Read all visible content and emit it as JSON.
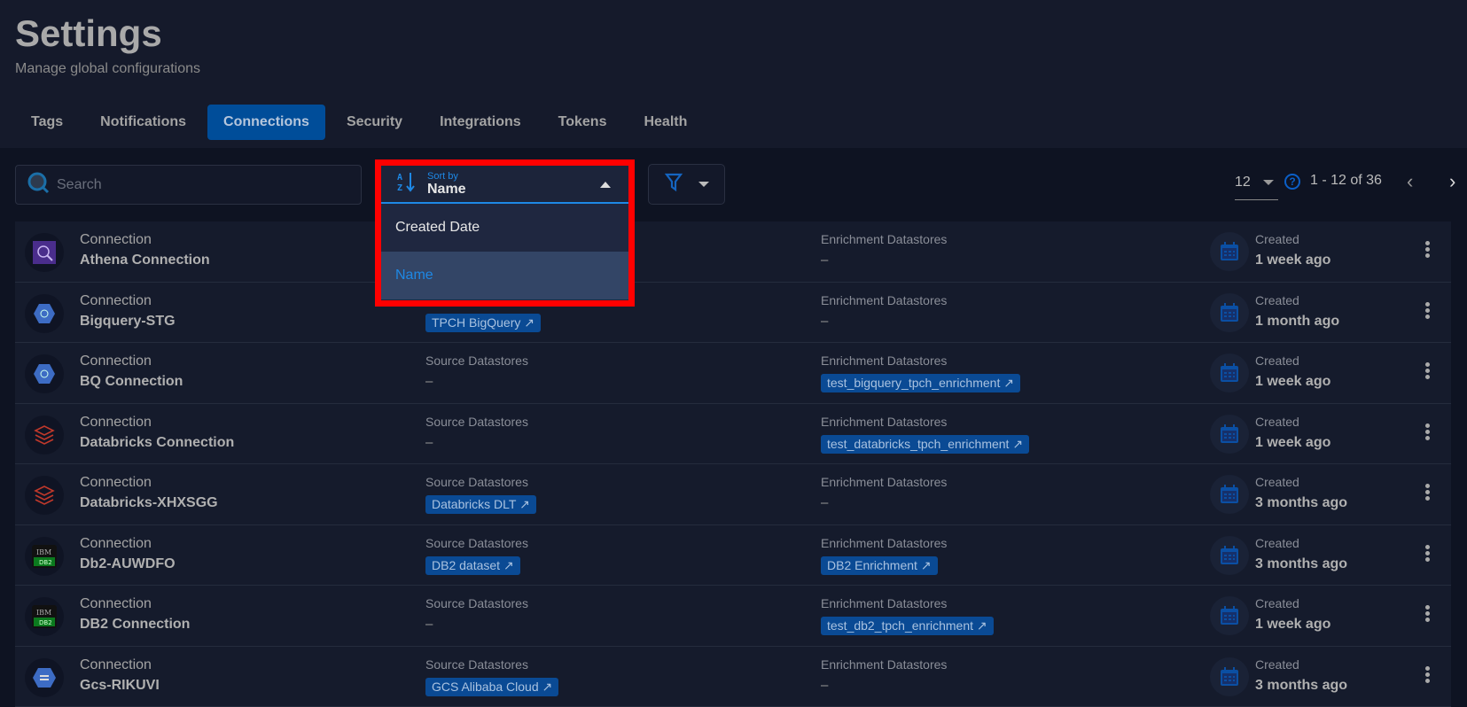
{
  "header": {
    "title": "Settings",
    "subtitle": "Manage global configurations"
  },
  "tabs": [
    {
      "label": "Tags"
    },
    {
      "label": "Notifications"
    },
    {
      "label": "Connections",
      "active": true
    },
    {
      "label": "Security"
    },
    {
      "label": "Integrations"
    },
    {
      "label": "Tokens"
    },
    {
      "label": "Health"
    }
  ],
  "search": {
    "placeholder": "Search",
    "value": ""
  },
  "sort": {
    "label": "Sort by",
    "value": "Name",
    "options": [
      "Created Date",
      "Name"
    ]
  },
  "pagination": {
    "per_page": "12",
    "range": "1 - 12 of 36"
  },
  "colors": {
    "accent": "#1e88e5",
    "tab_active": "#004d99",
    "tag_bg": "#0a4a94",
    "highlight": "#ff0000"
  },
  "rows": [
    {
      "type": "Connection",
      "name": "Athena Connection",
      "icon": "athena",
      "source_label": "",
      "source": "",
      "enrich_label": "Enrichment Datastores",
      "enrich": "–",
      "enrich_tag": false,
      "created_label": "Created",
      "created": "1 week ago"
    },
    {
      "type": "Connection",
      "name": "Bigquery-STG",
      "icon": "bigquery",
      "source_label": "",
      "source": "TPCH BigQuery",
      "source_tag": true,
      "enrich_label": "Enrichment Datastores",
      "enrich": "–",
      "enrich_tag": false,
      "created_label": "Created",
      "created": "1 month ago"
    },
    {
      "type": "Connection",
      "name": "BQ Connection",
      "icon": "bigquery",
      "source_label": "Source Datastores",
      "source": "–",
      "source_tag": false,
      "enrich_label": "Enrichment Datastores",
      "enrich": "test_bigquery_tpch_enrichment",
      "enrich_tag": true,
      "created_label": "Created",
      "created": "1 week ago"
    },
    {
      "type": "Connection",
      "name": "Databricks Connection",
      "icon": "databricks",
      "source_label": "Source Datastores",
      "source": "–",
      "source_tag": false,
      "enrich_label": "Enrichment Datastores",
      "enrich": "test_databricks_tpch_enrichment",
      "enrich_tag": true,
      "created_label": "Created",
      "created": "1 week ago"
    },
    {
      "type": "Connection",
      "name": "Databricks-XHXSGG",
      "icon": "databricks",
      "source_label": "Source Datastores",
      "source": "Databricks DLT",
      "source_tag": true,
      "enrich_label": "Enrichment Datastores",
      "enrich": "–",
      "enrich_tag": false,
      "created_label": "Created",
      "created": "3 months ago"
    },
    {
      "type": "Connection",
      "name": "Db2-AUWDFO",
      "icon": "db2",
      "source_label": "Source Datastores",
      "source": "DB2 dataset",
      "source_tag": true,
      "enrich_label": "Enrichment Datastores",
      "enrich": "DB2 Enrichment",
      "enrich_tag": true,
      "created_label": "Created",
      "created": "3 months ago"
    },
    {
      "type": "Connection",
      "name": "DB2 Connection",
      "icon": "db2",
      "source_label": "Source Datastores",
      "source": "–",
      "source_tag": false,
      "enrich_label": "Enrichment Datastores",
      "enrich": "test_db2_tpch_enrichment",
      "enrich_tag": true,
      "created_label": "Created",
      "created": "1 week ago"
    },
    {
      "type": "Connection",
      "name": "Gcs-RIKUVI",
      "icon": "gcs",
      "source_label": "Source Datastores",
      "source": "GCS Alibaba Cloud",
      "source_tag": true,
      "enrich_label": "Enrichment Datastores",
      "enrich": "–",
      "enrich_tag": false,
      "created_label": "Created",
      "created": "3 months ago"
    }
  ]
}
